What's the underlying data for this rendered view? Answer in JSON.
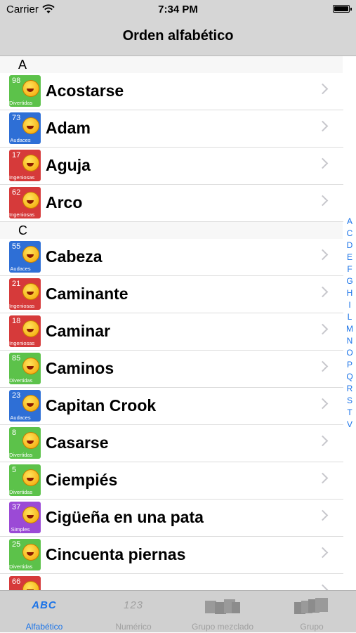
{
  "status": {
    "carrier": "Carrier",
    "time": "7:34 PM"
  },
  "nav": {
    "title": "Orden alfabético"
  },
  "sections": [
    {
      "letter": "A",
      "items": [
        {
          "label": "Acostarse",
          "num": "98",
          "category": "Divertidas",
          "color": "#5cc24a"
        },
        {
          "label": "Adam",
          "num": "73",
          "category": "Audaces",
          "color": "#2e6fd6"
        },
        {
          "label": "Aguja",
          "num": "17",
          "category": "Ingeniosas",
          "color": "#d63a3a"
        },
        {
          "label": "Arco",
          "num": "62",
          "category": "Ingeniosas",
          "color": "#d63a3a"
        }
      ]
    },
    {
      "letter": "C",
      "items": [
        {
          "label": "Cabeza",
          "num": "55",
          "category": "Audaces",
          "color": "#2e6fd6"
        },
        {
          "label": "Caminante",
          "num": "21",
          "category": "Ingeniosas",
          "color": "#d63a3a"
        },
        {
          "label": "Caminar",
          "num": "18",
          "category": "Ingeniosas",
          "color": "#d63a3a"
        },
        {
          "label": "Caminos",
          "num": "85",
          "category": "Divertidas",
          "color": "#5cc24a"
        },
        {
          "label": "Capitan Crook",
          "num": "23",
          "category": "Audaces",
          "color": "#2e6fd6"
        },
        {
          "label": "Casarse",
          "num": "8",
          "category": "Divertidas",
          "color": "#5cc24a"
        },
        {
          "label": "Ciempiés",
          "num": "5",
          "category": "Divertidas",
          "color": "#5cc24a"
        },
        {
          "label": "Cigüeña en una pata",
          "num": "37",
          "category": "Simples",
          "color": "#9b4ad6"
        },
        {
          "label": "Cincuenta piernas",
          "num": "25",
          "category": "Divertidas",
          "color": "#5cc24a"
        },
        {
          "label": "",
          "num": "66",
          "category": "",
          "color": "#d63a3a"
        }
      ]
    }
  ],
  "index_letters": [
    "A",
    "C",
    "D",
    "E",
    "F",
    "G",
    "H",
    "I",
    "L",
    "M",
    "N",
    "O",
    "P",
    "Q",
    "R",
    "S",
    "T",
    "V"
  ],
  "tabs": [
    {
      "label": "Alfabético",
      "icon": "abc-icon",
      "active": true
    },
    {
      "label": "Numérico",
      "icon": "numbers-icon",
      "active": false
    },
    {
      "label": "Grupo mezclado",
      "icon": "cards-mixed-icon",
      "active": false
    },
    {
      "label": "Grupo",
      "icon": "cards-group-icon",
      "active": false
    }
  ],
  "tab_icon_text": {
    "abc": "ABC",
    "num": "123"
  },
  "colors": {
    "accent": "#1a73e8",
    "tabbar": "#d0d0d0",
    "header": "#d6d6d6"
  }
}
